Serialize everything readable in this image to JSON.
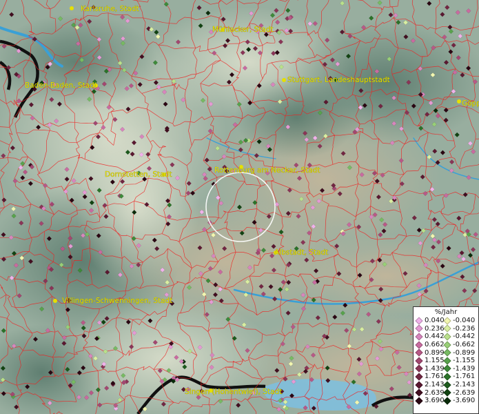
{
  "cities": [
    {
      "name": "Karlsruhe, Stadt",
      "dot": "city-karlsruhe"
    },
    {
      "name": "Mühlacker, Stadt",
      "dot": "city-muehlacker"
    },
    {
      "name": "Baden-Baden, Stadt",
      "dot": "city-baden"
    },
    {
      "name": "Stuttgart, Landeshauptstadt",
      "dot": "city-stuttgart"
    },
    {
      "name": "Göpp",
      "dot": "city-goepp"
    },
    {
      "name": "Dornstetten, Stadt",
      "dot": "city-dornstetten"
    },
    {
      "name": "Rottenburg am Neckar, Stadt",
      "dot": "city-rottenburg"
    },
    {
      "name": "Albstadt, Stadt",
      "dot": "city-albstadt"
    },
    {
      "name": "Villingen-Schwenningen, Stadt",
      "dot": "city-villingen"
    },
    {
      "name": "Singen (Hohentwiel), Stadt",
      "dot": "city-singen"
    }
  ],
  "legend": {
    "title": "%/Jahr",
    "positive": [
      {
        "value": "0.040",
        "color": "#f0b2ea"
      },
      {
        "value": "0.236",
        "color": "#e59ad4"
      },
      {
        "value": "0.442",
        "color": "#d886bd"
      },
      {
        "value": "0.662",
        "color": "#c96ba0"
      },
      {
        "value": "0.899",
        "color": "#b85987"
      },
      {
        "value": "1.155",
        "color": "#a34770"
      },
      {
        "value": "1.439",
        "color": "#8a3557"
      },
      {
        "value": "1.761",
        "color": "#722642"
      },
      {
        "value": "2.143",
        "color": "#5a1830"
      },
      {
        "value": "2.639",
        "color": "#420e20"
      },
      {
        "value": "3.690",
        "color": "#2a0612"
      }
    ],
    "negative": [
      {
        "value": "-0.040",
        "color": "#f2f6b0"
      },
      {
        "value": "-0.236",
        "color": "#d9eea1"
      },
      {
        "value": "-0.442",
        "color": "#b9e08b"
      },
      {
        "value": "-0.662",
        "color": "#98cf77"
      },
      {
        "value": "-0.899",
        "color": "#77ba63"
      },
      {
        "value": "-1.155",
        "color": "#58a24d"
      },
      {
        "value": "-1.439",
        "color": "#3e8a3a"
      },
      {
        "value": "-1.761",
        "color": "#2b7229"
      },
      {
        "value": "-2.143",
        "color": "#1c5a1c"
      },
      {
        "value": "-2.639",
        "color": "#124312"
      },
      {
        "value": "-3.690",
        "color": "#0a2b0a"
      }
    ]
  },
  "colors": {
    "terrain_light": "#a9bcae",
    "terrain_dark": "#6f8e7d",
    "boundary_line": "#ee2020",
    "river": "#3aa0d6",
    "state_border": "#101010",
    "label_text": "#e6e000",
    "highlight_ring": "#ffffff"
  }
}
